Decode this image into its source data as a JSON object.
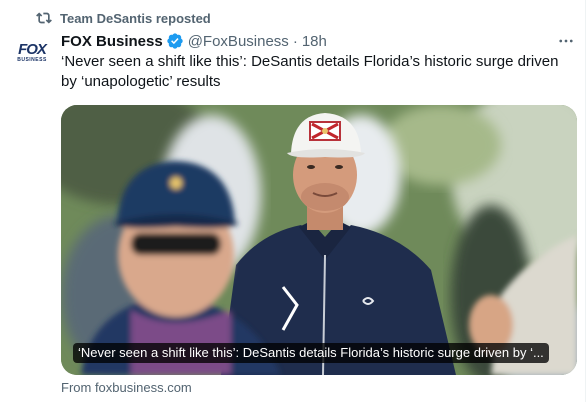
{
  "repost": {
    "text": "Team DeSantis reposted"
  },
  "author": {
    "name": "FOX Business",
    "handle": "@FoxBusiness",
    "separator": "·",
    "time": "18h",
    "avatar_logo": "FOX",
    "avatar_sub": "BUSINESS"
  },
  "tweet": {
    "text": "‘Never seen a shift like this’: DeSantis details Florida’s historic surge driven by ‘unapologetic’ results"
  },
  "card": {
    "title": "‘Never seen a shift like this’: DeSantis details Florida’s historic surge driven by ‘...",
    "source": "From foxbusiness.com"
  },
  "icons": {
    "repost": "repost-icon",
    "verified": "verified-badge-icon",
    "more": "more-options-icon"
  },
  "colors": {
    "secondary_text": "#536471",
    "verified": "#1d9bf0",
    "logo": "#1c3466"
  }
}
